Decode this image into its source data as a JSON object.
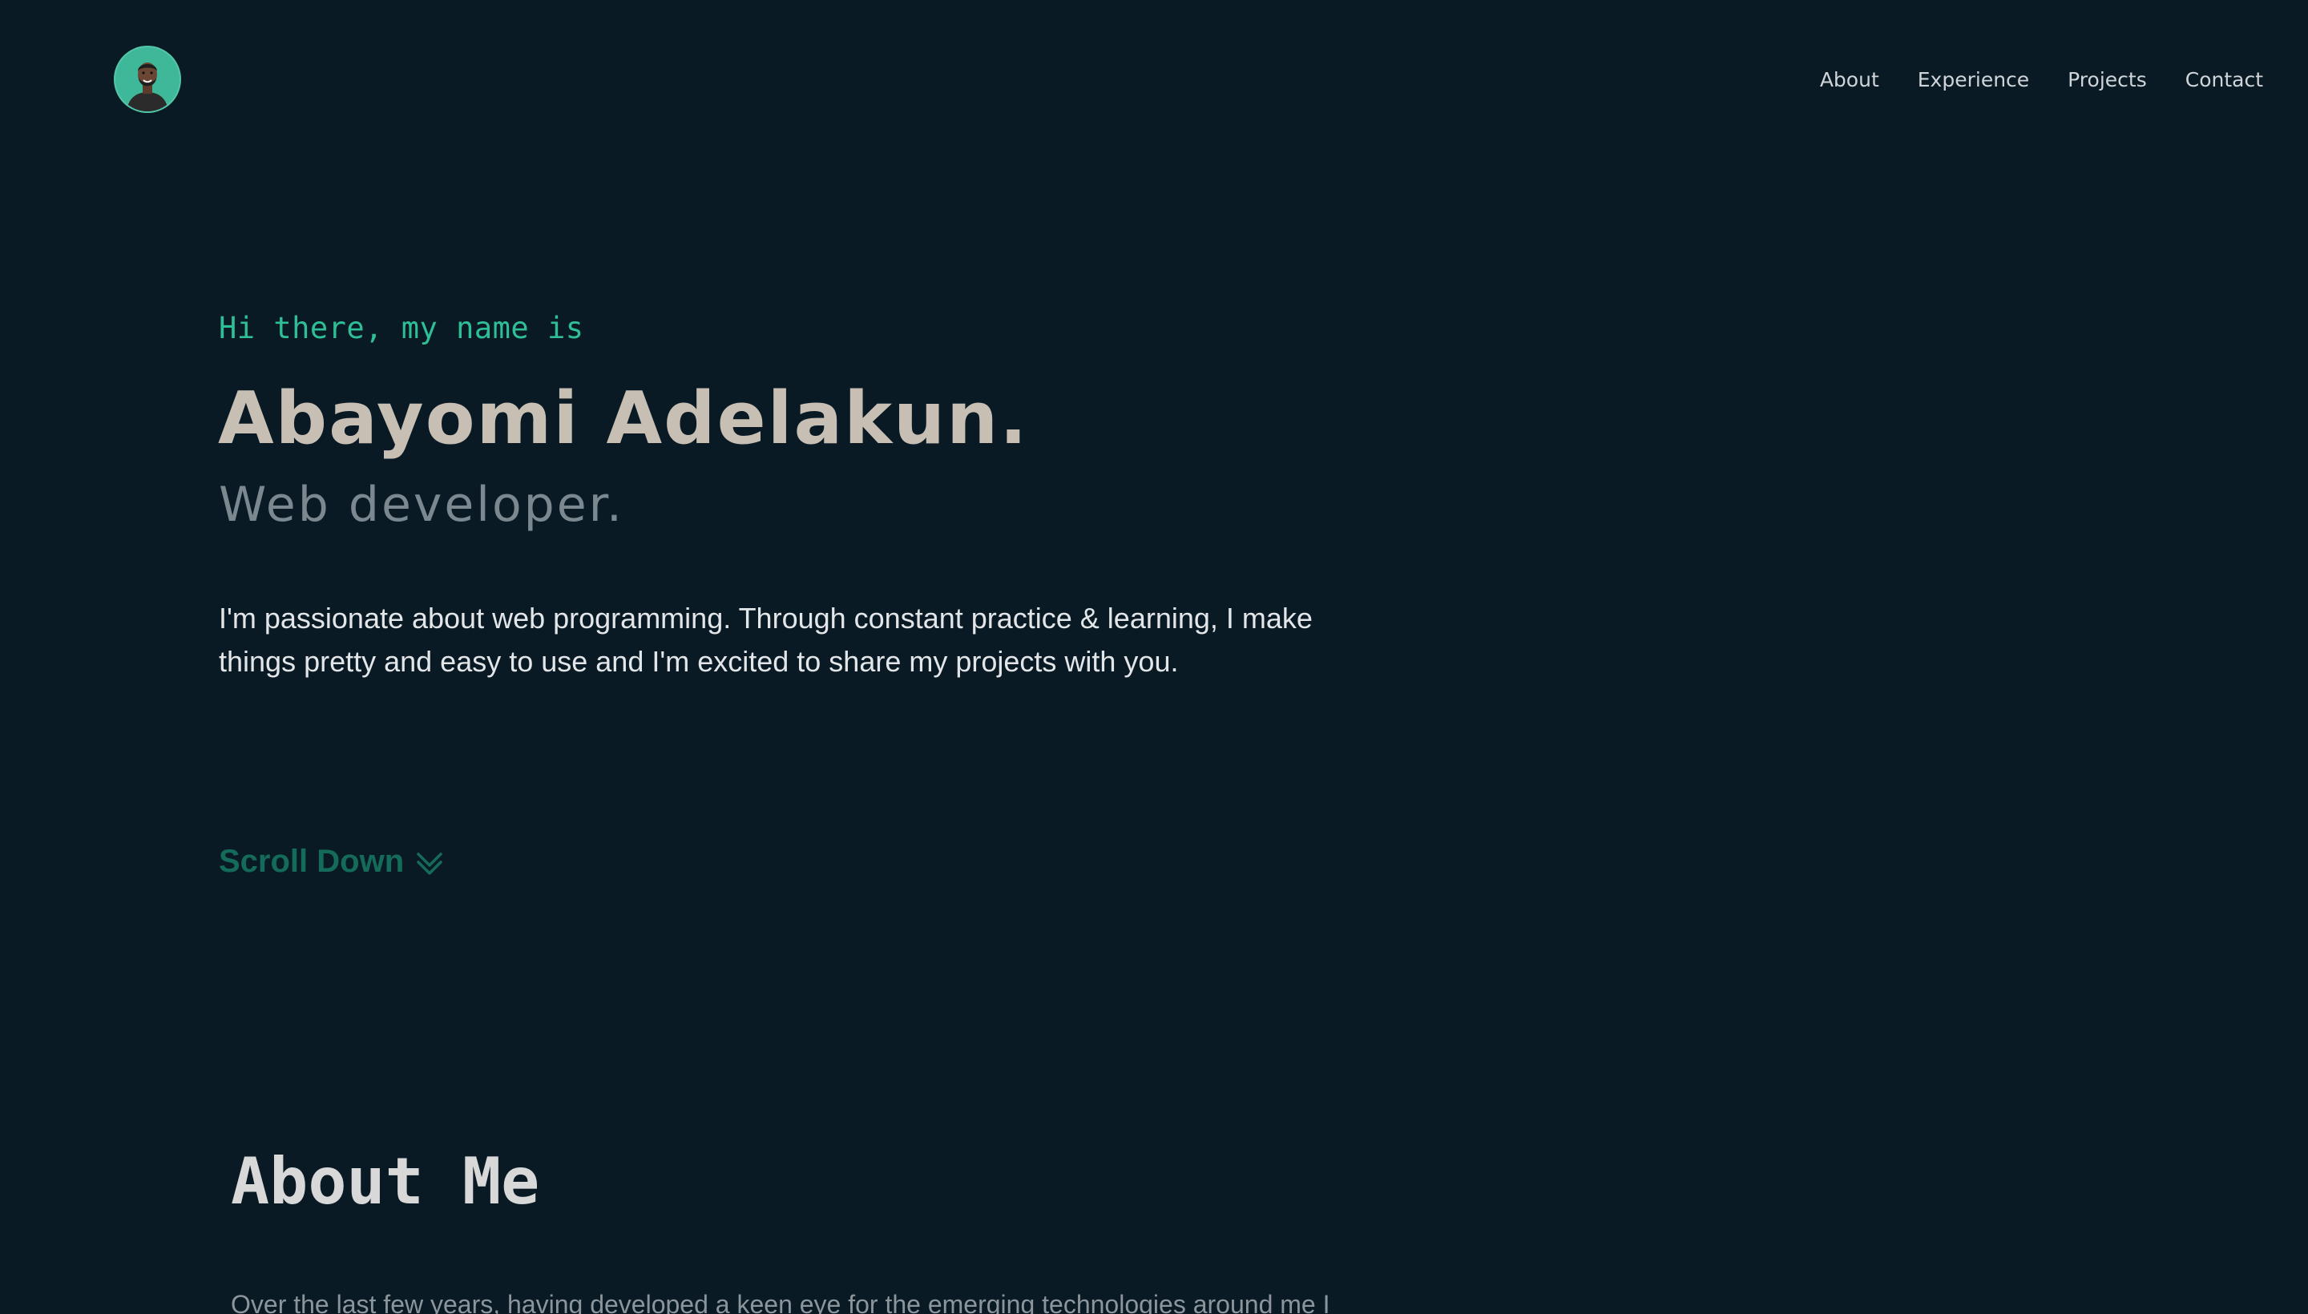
{
  "header": {
    "avatar_alt": "profile photo",
    "nav": [
      {
        "label": "About"
      },
      {
        "label": "Experience"
      },
      {
        "label": "Projects"
      },
      {
        "label": "Contact"
      }
    ]
  },
  "hero": {
    "greeting": "Hi there, my name is",
    "name": "Abayomi Adelakun.",
    "role": "Web developer.",
    "intro": "I'm passionate about web programming. Through constant practice & learning, I make things pretty and easy to use and I'm excited to share my projects with you.",
    "scroll_label": "Scroll Down",
    "scroll_icon": "double-chevron-down-icon"
  },
  "about": {
    "title": "About Me",
    "text": "Over the last few years, having developed a keen eye for the emerging technologies around me I"
  },
  "colors": {
    "background": "#091a25",
    "accent": "#2fbf97",
    "scroll_accent": "#156b59",
    "name_color": "#c8bfb4",
    "role_color": "#7b8890"
  }
}
